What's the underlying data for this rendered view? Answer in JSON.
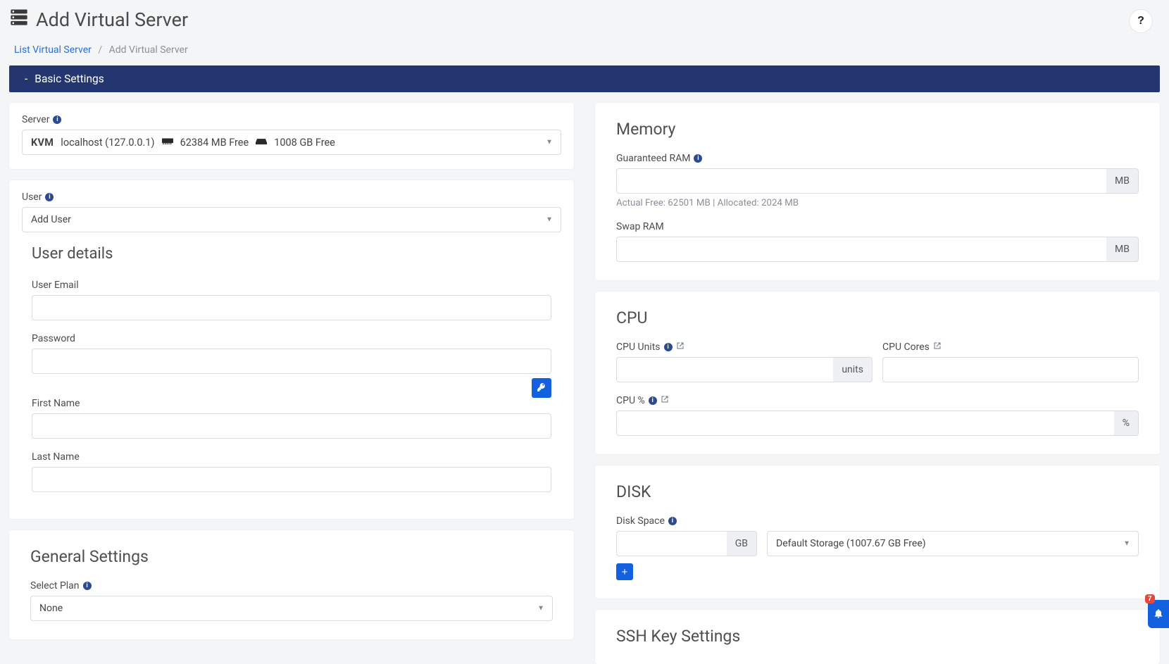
{
  "header": {
    "title": "Add Virtual Server",
    "help_glyph": "?"
  },
  "breadcrumb": {
    "link_text": "List Virtual Server",
    "separator": "/",
    "current": "Add Virtual Server"
  },
  "section_bar": {
    "prefix": "-",
    "title": "Basic Settings"
  },
  "server_card": {
    "label": "Server",
    "kvm": "KVM",
    "host": "localhost (127.0.0.1)",
    "mem_free": "62384 MB Free",
    "disk_free": "1008 GB Free"
  },
  "user_card": {
    "label": "User",
    "select_value": "Add User",
    "details_heading": "User details",
    "email_label": "User Email",
    "password_label": "Password",
    "first_name_label": "First Name",
    "last_name_label": "Last Name"
  },
  "general_card": {
    "heading": "General Settings",
    "plan_label": "Select Plan",
    "plan_value": "None"
  },
  "memory_card": {
    "heading": "Memory",
    "gram_label": "Guaranteed RAM",
    "unit": "MB",
    "note": "Actual Free: 62501 MB | Allocated: 2024 MB",
    "swap_label": "Swap RAM"
  },
  "cpu_card": {
    "heading": "CPU",
    "units_label": "CPU Units",
    "units_suffix": "units",
    "cores_label": "CPU Cores",
    "percent_label": "CPU %",
    "percent_suffix": "%"
  },
  "disk_card": {
    "heading": "DISK",
    "space_label": "Disk Space",
    "unit": "GB",
    "storage_value": "Default Storage (1007.67 GB Free)",
    "plus": "+"
  },
  "ssh_card": {
    "heading": "SSH Key Settings"
  },
  "notifications": {
    "count": "7"
  }
}
